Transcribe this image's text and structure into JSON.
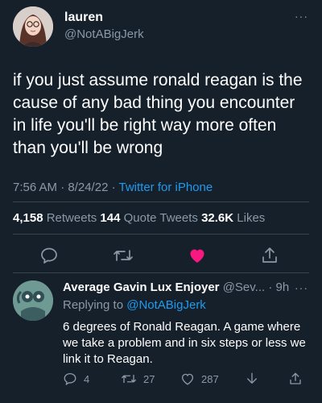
{
  "tweet": {
    "author_name": "lauren",
    "author_handle": "@NotABigJerk",
    "more": "···",
    "text": "if you just assume ronald reagan is the cause of any bad thing you encounter in life you'll be right way more often than you'll be wrong",
    "time": "7:56 AM · 8/24/22 · ",
    "source": "Twitter for iPhone",
    "stats": {
      "retweets_count": "4,158",
      "retweets_label": " Retweets  ",
      "quotes_count": "144",
      "quotes_label": " Quote Tweets  ",
      "likes_count": "32.6K",
      "likes_label": " Likes"
    },
    "icons": [
      "reply-icon",
      "retweet-icon",
      "like-icon",
      "share-icon"
    ],
    "liked_color": "#f91880"
  },
  "reply": {
    "author_name": "Average Gavin Lux Enjoyer",
    "meta": " @Sev... · 9h",
    "more": "···",
    "replying_prefix": "Replying to ",
    "replying_handle": "@NotABigJerk",
    "text": "6 degrees of Ronald Reagan. A game where we take a problem and in six steps or less we link it to Reagan.",
    "actions": {
      "replies": "4",
      "retweets": "27",
      "likes": "287"
    }
  },
  "colors": {
    "background": "#15202b",
    "muted": "#8b98a5",
    "link": "#1d9bf0",
    "divider": "#38444d"
  }
}
